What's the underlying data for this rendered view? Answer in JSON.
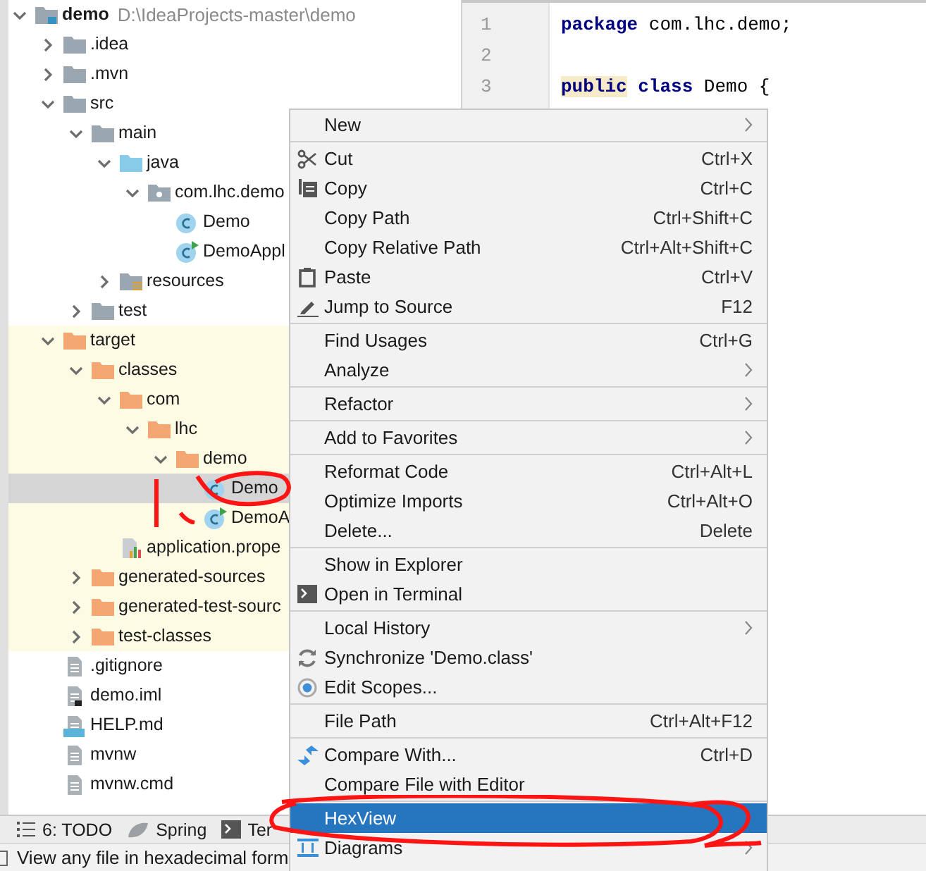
{
  "project_tree": [
    {
      "label": "demo",
      "path": "D:\\IdeaProjects-master\\demo",
      "kind": "module",
      "expanded": true,
      "selected": false,
      "children": [
        {
          "label": ".idea",
          "kind": "folder",
          "expanded": false,
          "selected": false
        },
        {
          "label": ".mvn",
          "kind": "folder",
          "expanded": false,
          "selected": false
        },
        {
          "label": "src",
          "kind": "folder",
          "expanded": true,
          "selected": false,
          "children": [
            {
              "label": "main",
              "kind": "folder",
              "expanded": true,
              "selected": false,
              "children": [
                {
                  "label": "java",
                  "kind": "source-folder",
                  "expanded": true,
                  "selected": false,
                  "children": [
                    {
                      "label": "com.lhc.demo",
                      "kind": "package",
                      "expanded": true,
                      "selected": false,
                      "children": [
                        {
                          "label": "Demo",
                          "kind": "class",
                          "selected": false
                        },
                        {
                          "label": "DemoAppl",
                          "kind": "spring-class",
                          "selected": false
                        }
                      ]
                    }
                  ]
                },
                {
                  "label": "resources",
                  "kind": "resources-folder",
                  "expanded": false,
                  "selected": false
                }
              ]
            },
            {
              "label": "test",
              "kind": "folder",
              "expanded": false,
              "selected": false
            }
          ]
        },
        {
          "label": "target",
          "kind": "excluded-folder",
          "expanded": true,
          "selected": false,
          "children": [
            {
              "label": "classes",
              "kind": "excluded-folder",
              "expanded": true,
              "selected": false,
              "children": [
                {
                  "label": "com",
                  "kind": "excluded-folder",
                  "expanded": true,
                  "selected": false,
                  "children": [
                    {
                      "label": "lhc",
                      "kind": "excluded-folder",
                      "expanded": true,
                      "selected": false,
                      "children": [
                        {
                          "label": "demo",
                          "kind": "excluded-folder",
                          "expanded": true,
                          "selected": false,
                          "children": [
                            {
                              "label": "Demo",
                              "kind": "class",
                              "selected": true
                            },
                            {
                              "label": "DemoA",
                              "kind": "spring-class",
                              "selected": false
                            }
                          ]
                        }
                      ]
                    }
                  ]
                },
                {
                  "label": "application.prope",
                  "kind": "properties",
                  "selected": false
                }
              ]
            },
            {
              "label": "generated-sources",
              "kind": "excluded-folder",
              "expanded": false,
              "selected": false
            },
            {
              "label": "generated-test-sourc",
              "kind": "excluded-folder",
              "expanded": false,
              "selected": false
            },
            {
              "label": "test-classes",
              "kind": "excluded-folder",
              "expanded": false,
              "selected": false
            }
          ]
        },
        {
          "label": ".gitignore",
          "kind": "file",
          "selected": false
        },
        {
          "label": "demo.iml",
          "kind": "iml",
          "selected": false
        },
        {
          "label": "HELP.md",
          "kind": "markdown",
          "selected": false
        },
        {
          "label": "mvnw",
          "kind": "file",
          "selected": false
        },
        {
          "label": "mvnw.cmd",
          "kind": "file",
          "selected": false
        }
      ]
    }
  ],
  "editor": {
    "lines": [
      {
        "number": "1",
        "tokens": [
          {
            "text": "package",
            "kind": "keyword",
            "highlighted": false
          },
          {
            "text": " com.lhc.demo;",
            "kind": "plain",
            "highlighted": false
          }
        ]
      },
      {
        "number": "2"
      },
      {
        "number": "3",
        "tokens": [
          {
            "text": "public",
            "kind": "keyword",
            "highlighted": true
          },
          {
            "text": " class",
            "kind": "keyword",
            "highlighted": false
          },
          {
            "text": " Demo {",
            "kind": "plain",
            "highlighted": false
          }
        ]
      }
    ]
  },
  "context_menu": [
    {
      "kind": "item",
      "label": "New",
      "submenu": true,
      "selected": false
    },
    {
      "kind": "separator"
    },
    {
      "kind": "item",
      "label": "Cut",
      "shortcut": "Ctrl+X",
      "selected": false
    },
    {
      "kind": "item",
      "label": "Copy",
      "shortcut": "Ctrl+C",
      "selected": false
    },
    {
      "kind": "item",
      "label": "Copy Path",
      "shortcut": "Ctrl+Shift+C",
      "selected": false
    },
    {
      "kind": "item",
      "label": "Copy Relative Path",
      "shortcut": "Ctrl+Alt+Shift+C",
      "selected": false
    },
    {
      "kind": "item",
      "label": "Paste",
      "shortcut": "Ctrl+V",
      "selected": false
    },
    {
      "kind": "item",
      "label": "Jump to Source",
      "shortcut": "F12",
      "selected": false
    },
    {
      "kind": "separator"
    },
    {
      "kind": "item",
      "label": "Find Usages",
      "shortcut": "Ctrl+G",
      "selected": false
    },
    {
      "kind": "item",
      "label": "Analyze",
      "submenu": true,
      "selected": false
    },
    {
      "kind": "separator"
    },
    {
      "kind": "item",
      "label": "Refactor",
      "submenu": true,
      "selected": false
    },
    {
      "kind": "separator"
    },
    {
      "kind": "item",
      "label": "Add to Favorites",
      "submenu": true,
      "selected": false
    },
    {
      "kind": "separator"
    },
    {
      "kind": "item",
      "label": "Reformat Code",
      "shortcut": "Ctrl+Alt+L",
      "selected": false
    },
    {
      "kind": "item",
      "label": "Optimize Imports",
      "shortcut": "Ctrl+Alt+O",
      "selected": false
    },
    {
      "kind": "item",
      "label": "Delete...",
      "shortcut": "Delete",
      "selected": false
    },
    {
      "kind": "separator"
    },
    {
      "kind": "item",
      "label": "Show in Explorer",
      "selected": false
    },
    {
      "kind": "item",
      "label": "Open in Terminal",
      "selected": false
    },
    {
      "kind": "separator"
    },
    {
      "kind": "item",
      "label": "Local History",
      "submenu": true,
      "selected": false
    },
    {
      "kind": "item",
      "label": "Synchronize 'Demo.class'",
      "selected": false
    },
    {
      "kind": "item",
      "label": "Edit Scopes...",
      "selected": false
    },
    {
      "kind": "separator"
    },
    {
      "kind": "item",
      "label": "File Path",
      "shortcut": "Ctrl+Alt+F12",
      "selected": false
    },
    {
      "kind": "separator"
    },
    {
      "kind": "item",
      "label": "Compare With...",
      "shortcut": "Ctrl+D",
      "selected": false
    },
    {
      "kind": "item",
      "label": "Compare File with Editor",
      "selected": false
    },
    {
      "kind": "separator"
    },
    {
      "kind": "item",
      "label": "HexView",
      "selected": true
    },
    {
      "kind": "item",
      "label": "Diagrams",
      "submenu": true,
      "selected": false
    }
  ],
  "tool_windows": [
    {
      "label": "6: TODO",
      "kind": "todo"
    },
    {
      "label": "Spring",
      "kind": "spring"
    },
    {
      "label": "Ter",
      "kind": "terminal"
    }
  ],
  "status_bar": {
    "text": "View any file in hexadecimal form"
  }
}
